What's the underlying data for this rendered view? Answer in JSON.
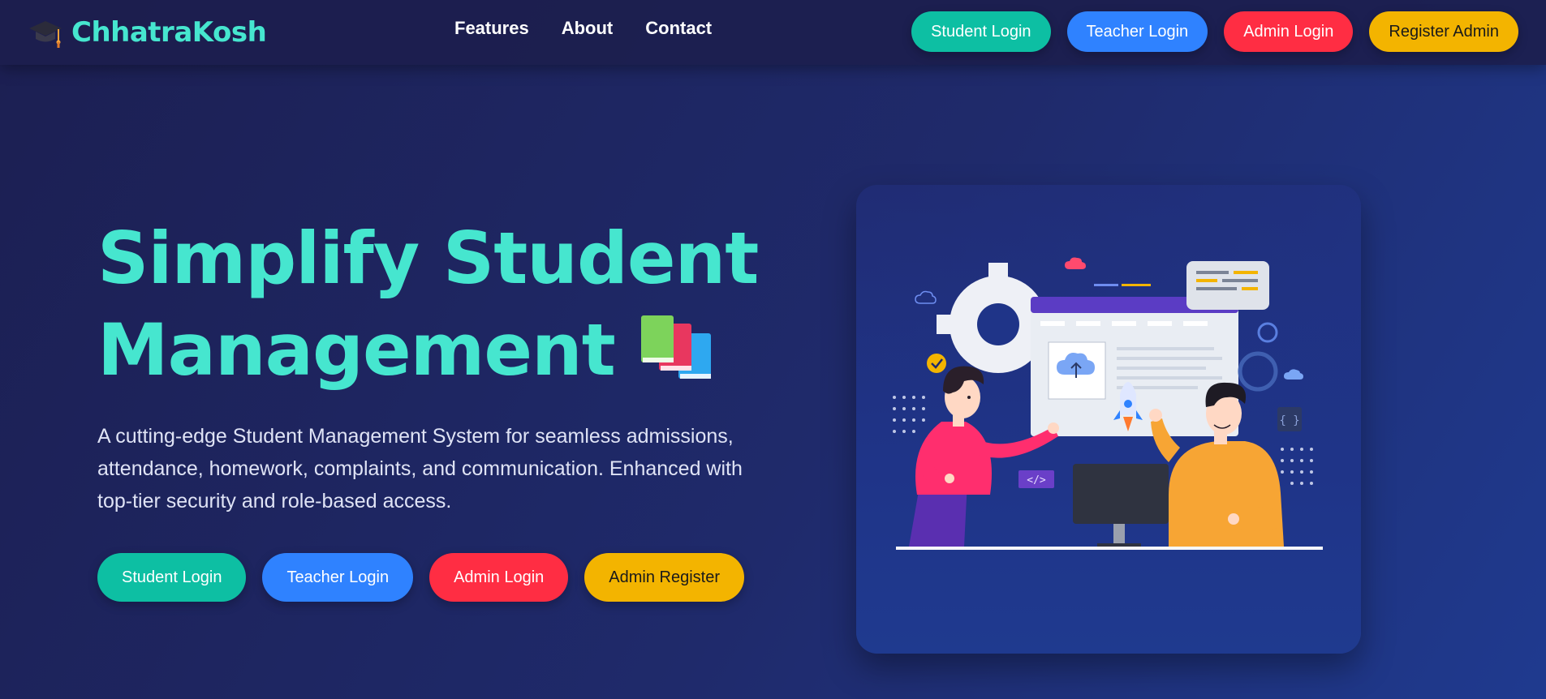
{
  "brand": {
    "name": "ChhatraKosh",
    "icon": "graduation-cap-icon"
  },
  "nav": {
    "links": [
      "Features",
      "About",
      "Contact"
    ],
    "buttons": {
      "student": "Student Login",
      "teacher": "Teacher Login",
      "admin": "Admin Login",
      "register": "Register Admin"
    }
  },
  "hero": {
    "title_line1": "Simplify Student",
    "title_line2": "Management",
    "title_icon": "books-icon",
    "description": "A cutting-edge Student Management System for seamless admissions, attendance, homework, complaints, and communication. Enhanced with top-tier security and role-based access.",
    "buttons": {
      "student": "Student Login",
      "teacher": "Teacher Login",
      "admin": "Admin Login",
      "register": "Admin Register"
    }
  },
  "illustration": {
    "code_tag": "</>",
    "braces_tag": "{ }"
  },
  "colors": {
    "accent": "#46e6cf",
    "teal": "#0dbfa3",
    "blue": "#2f82ff",
    "red": "#ff2d43",
    "yellow": "#f3b400"
  }
}
